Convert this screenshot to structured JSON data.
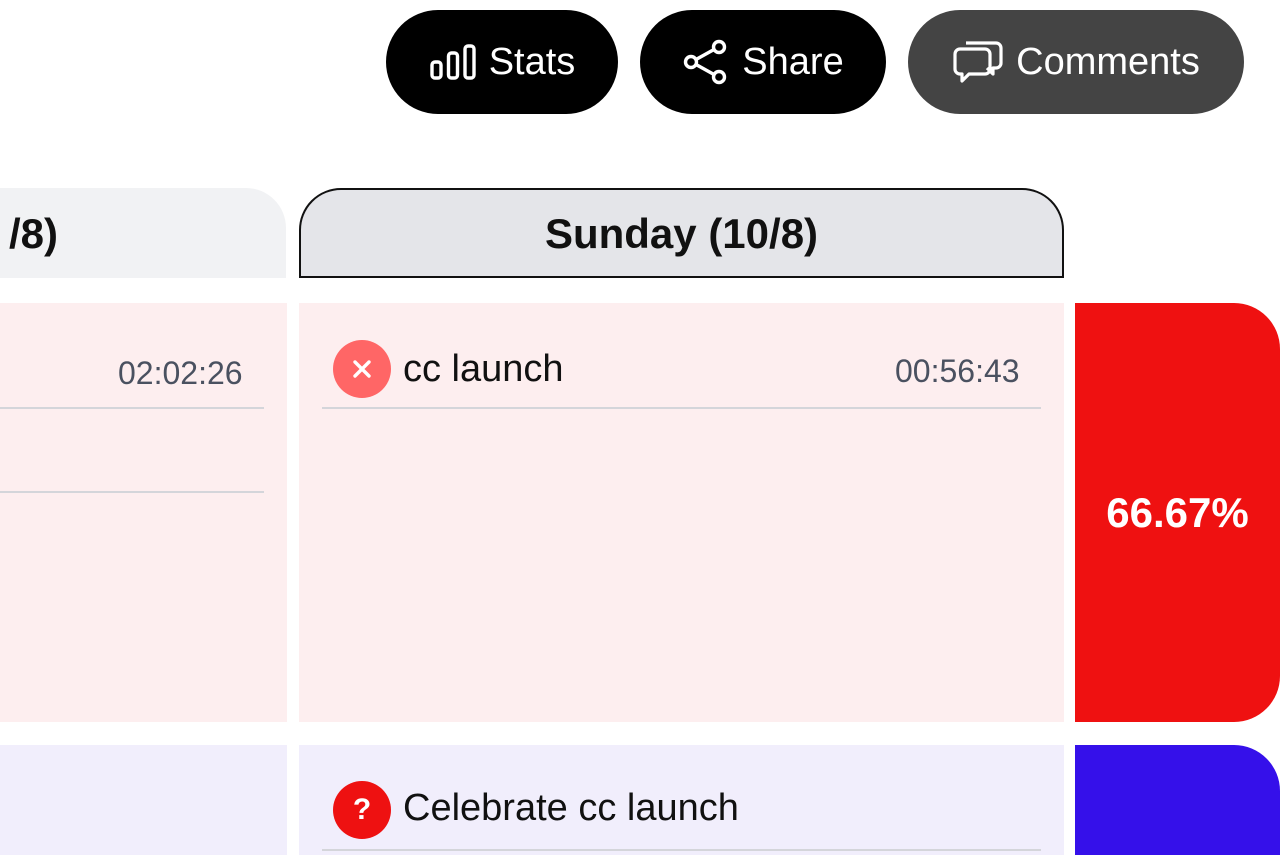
{
  "toolbar": {
    "stats_label": "Stats",
    "share_label": "Share",
    "comments_label": "Comments"
  },
  "days": [
    {
      "header": "/8)"
    },
    {
      "header": "Sunday (10/8)"
    }
  ],
  "rows": [
    {
      "prev_time": "02:02:26",
      "task": "cc launch",
      "status": "failed",
      "time": "00:56:43",
      "percent": "66.67%",
      "color": "#ef1111"
    },
    {
      "task": "Celebrate cc launch",
      "status": "unknown",
      "status_symbol": "?",
      "color": "#3510ea"
    }
  ],
  "colors": {
    "failed": "#ff6666",
    "unknown": "#ee1111",
    "pink_bg": "#fdeeef",
    "lavender_bg": "#f1eefc"
  }
}
